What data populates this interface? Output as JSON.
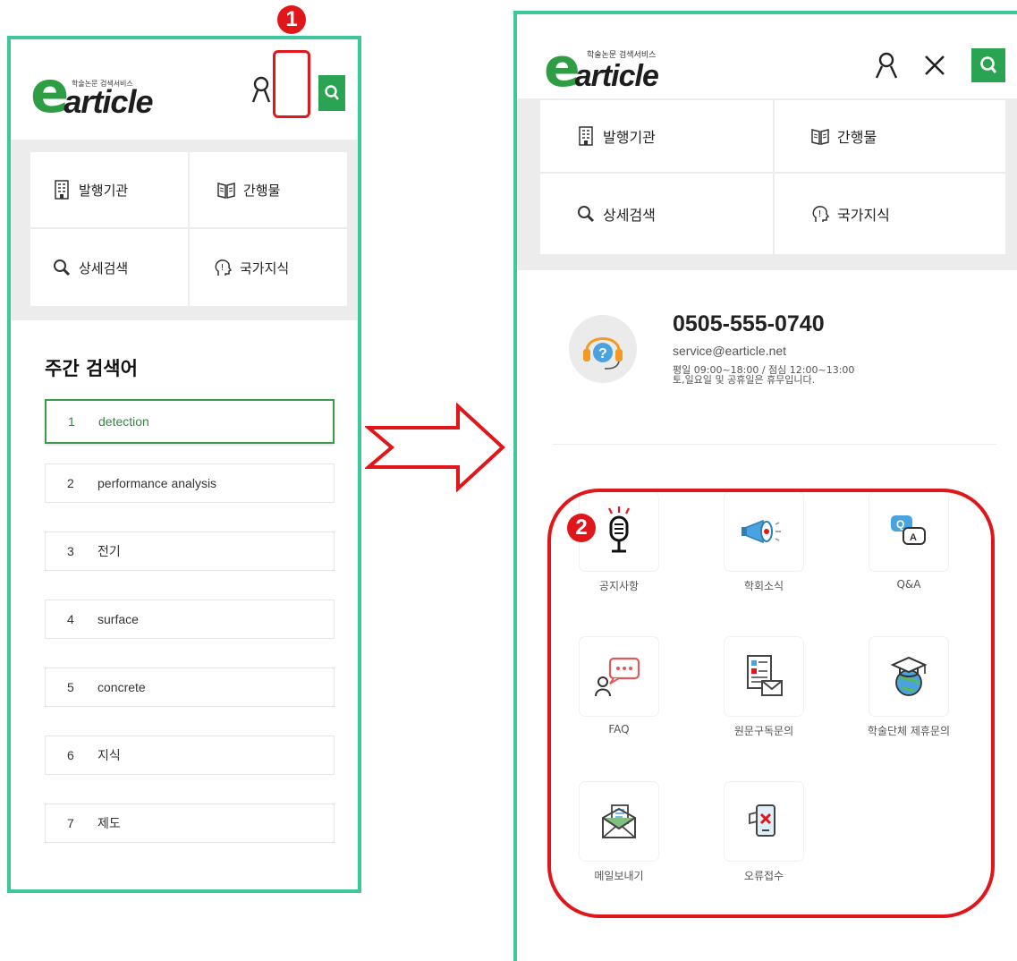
{
  "brand": {
    "logo_letter": "e",
    "logo_word": "article",
    "tagline": "학술논문 검색서비스",
    "accent_green": "#2aa353",
    "frame_color": "#3dc79a",
    "annotation_red": "#e0161b"
  },
  "left_screen": {
    "header_icons": [
      "user-icon",
      "hamburger-menu-icon",
      "search-icon"
    ],
    "quick_menu": [
      {
        "label": "발행기관",
        "icon": "building-icon"
      },
      {
        "label": "간행물",
        "icon": "book-icon"
      },
      {
        "label": "상세검색",
        "icon": "magnifier-icon"
      },
      {
        "label": "국가지식",
        "icon": "head-knowledge-icon"
      }
    ],
    "weekly_title": "주간 검색어",
    "keywords": [
      {
        "rank": "1",
        "term": "detection"
      },
      {
        "rank": "2",
        "term": "performance analysis"
      },
      {
        "rank": "3",
        "term": "전기"
      },
      {
        "rank": "4",
        "term": "surface"
      },
      {
        "rank": "5",
        "term": "concrete"
      },
      {
        "rank": "6",
        "term": "지식"
      },
      {
        "rank": "7",
        "term": "제도"
      }
    ]
  },
  "right_screen": {
    "header_icons": [
      "user-icon",
      "close-icon",
      "search-icon"
    ],
    "quick_menu": [
      {
        "label": "발행기관",
        "icon": "building-icon"
      },
      {
        "label": "간행물",
        "icon": "book-icon"
      },
      {
        "label": "상세검색",
        "icon": "magnifier-icon"
      },
      {
        "label": "국가지식",
        "icon": "head-knowledge-icon"
      }
    ],
    "contact": {
      "phone": "0505-555-0740",
      "email": "service@earticle.net",
      "hours_line1": "평일 09:00~18:00 / 점심 12:00~13:00",
      "hours_line2": "토,일요일 및 공휴일은 휴무입니다."
    },
    "services": [
      {
        "label": "공지사항",
        "icon": "microphone-notice-icon"
      },
      {
        "label": "학회소식",
        "icon": "megaphone-icon"
      },
      {
        "label": "Q&A",
        "icon": "qa-chat-icon"
      },
      {
        "label": "FAQ",
        "icon": "faq-chat-icon"
      },
      {
        "label": "원문구독문의",
        "icon": "document-mail-icon"
      },
      {
        "label": "학술단체 제휴문의",
        "icon": "graduation-globe-icon"
      },
      {
        "label": "메일보내기",
        "icon": "envelope-icon"
      },
      {
        "label": "오류접수",
        "icon": "error-report-icon"
      }
    ]
  },
  "annotations": {
    "step1": "1",
    "step2": "2"
  }
}
